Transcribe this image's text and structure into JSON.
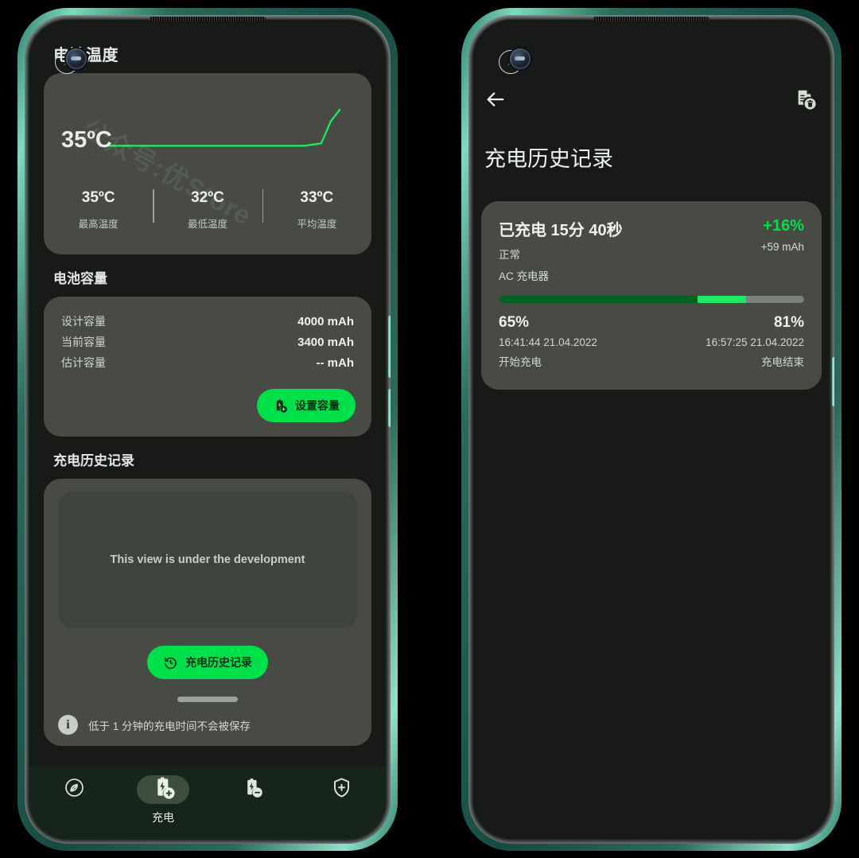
{
  "accent_green": "#00e04a",
  "card_bg": "#474b44",
  "screen_bg": "#181a18",
  "nav_bg": "#16251b",
  "left_screen": {
    "heading": "电池温度",
    "watermark": "公众号:优Store",
    "temperature": {
      "current": "35ºC",
      "stats": [
        {
          "value": "35ºC",
          "label": "最高温度"
        },
        {
          "value": "32ºC",
          "label": "最低温度"
        },
        {
          "value": "33ºC",
          "label": "平均温度"
        }
      ]
    },
    "capacity": {
      "section_label": "电池容量",
      "rows": [
        {
          "key": "设计容量",
          "value": "4000 mAh"
        },
        {
          "key": "当前容量",
          "value": "3400 mAh"
        },
        {
          "key": "估计容量",
          "value": "-- mAh"
        }
      ],
      "button_label": "设置容量",
      "button_icon": "battery-plus-icon"
    },
    "history": {
      "section_label": "充电历史记录",
      "placeholder_text": "This view is under the development",
      "button_label": "充电历史记录",
      "button_icon": "history-restore-icon",
      "info_icon": "info-icon",
      "info_text": "低于 1 分钟的充电时间不会被保存"
    },
    "bottom_nav": {
      "items": [
        {
          "icon": "leaf-circle-icon",
          "label": "",
          "active": false
        },
        {
          "icon": "battery-charging-plus-icon",
          "label": "充电",
          "active": true
        },
        {
          "icon": "battery-discharging-minus-icon",
          "label": "",
          "active": false
        },
        {
          "icon": "shield-plus-icon",
          "label": "",
          "active": false
        }
      ]
    }
  },
  "right_screen": {
    "back_icon": "back-arrow-icon",
    "delete_icon": "document-delete-icon",
    "title": "充电历史记录",
    "session": {
      "duration": "已充电 15分 40秒",
      "status": "正常",
      "source": "AC 充电器",
      "percent_gain": "+16%",
      "mah_gain": "+59 mAh",
      "start_percent": "65%",
      "start_time": "16:41:44 21.04.2022",
      "start_label": "开始充电",
      "end_percent": "81%",
      "end_time": "16:57:25 21.04.2022",
      "end_label": "充电结束",
      "bar_start_fraction": 65,
      "bar_gain_fraction": 16
    }
  },
  "chart_data": {
    "type": "line",
    "title": "电池温度",
    "ylabel": "ºC",
    "xlabel": "",
    "grid": false,
    "ylim": [
      30,
      36
    ],
    "series": [
      {
        "name": "电池温度",
        "color": "#1ee864",
        "x": [
          0,
          20,
          45,
          70,
          85,
          92,
          96,
          100
        ],
        "y": [
          32,
          32,
          32,
          32,
          32,
          32.2,
          34,
          35
        ]
      }
    ],
    "annotations": [
      "35ºC"
    ],
    "summary": {
      "max": 35,
      "min": 32,
      "avg": 33
    }
  }
}
